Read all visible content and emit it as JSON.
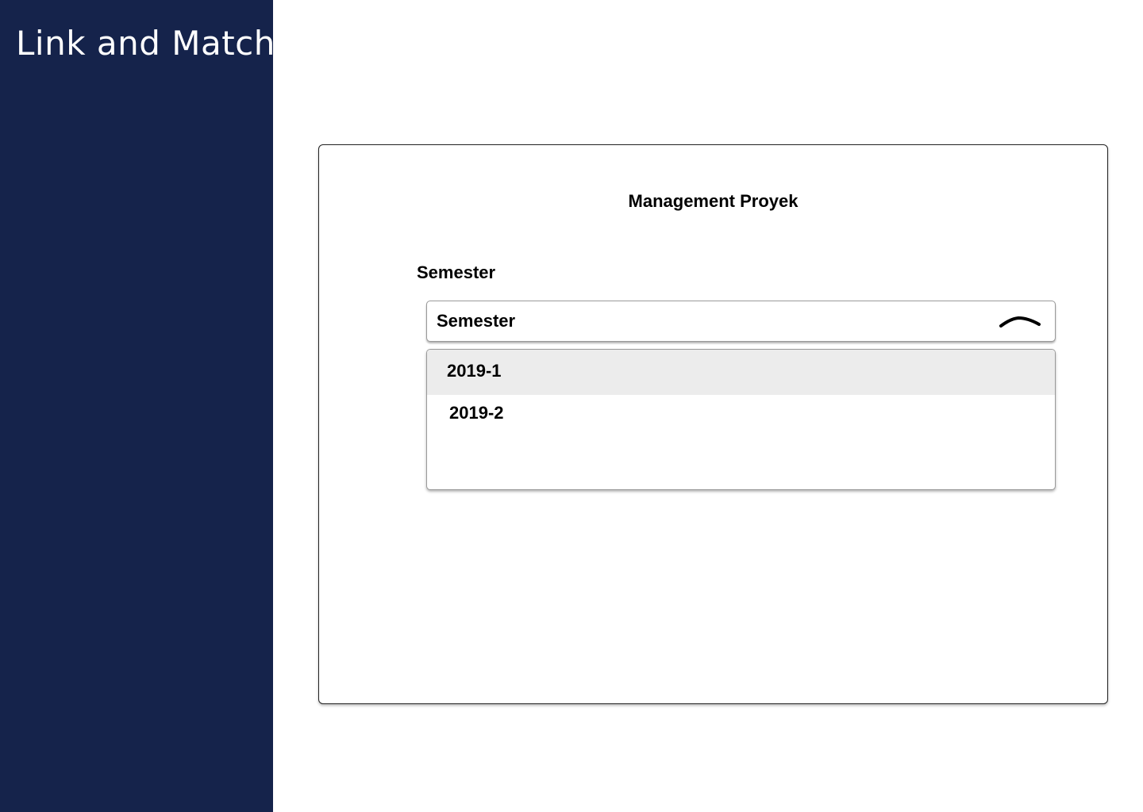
{
  "sidebar": {
    "brand": "Link and Match",
    "background_color": "#15234b"
  },
  "card": {
    "title": "Management Proyek",
    "field": {
      "label": "Semester",
      "select": {
        "value": "Semester",
        "expanded": true,
        "icon": "chevron-up-icon",
        "options": [
          {
            "label": "2019-1",
            "highlighted": true
          },
          {
            "label": "2019-2",
            "highlighted": false
          }
        ]
      }
    }
  }
}
